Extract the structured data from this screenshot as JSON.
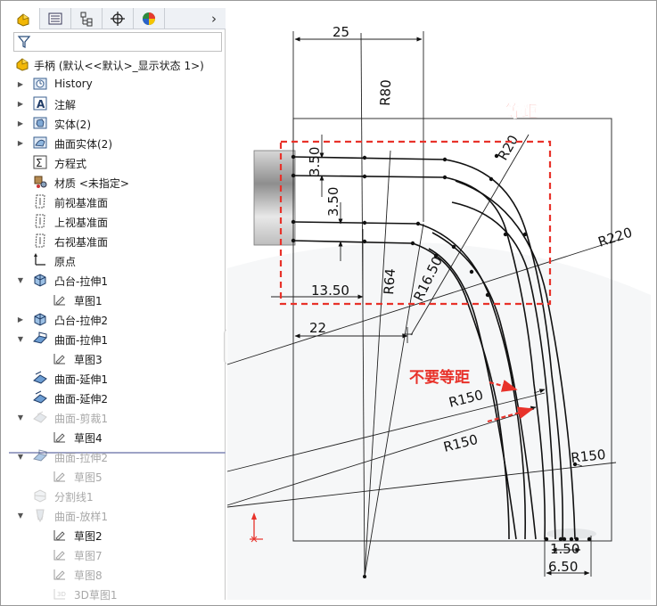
{
  "tree": {
    "root_label": "手柄 (默认<<默认>_显示状态 1>)",
    "items": [
      {
        "label": "History",
        "icon": "history-icon",
        "arrow": "right",
        "indent": 0,
        "dim": false
      },
      {
        "label": "注解",
        "icon": "annotation-icon",
        "arrow": "right",
        "indent": 0,
        "dim": false
      },
      {
        "label": "实体(2)",
        "icon": "solid-bodies-icon",
        "arrow": "right",
        "indent": 0,
        "dim": false
      },
      {
        "label": "曲面实体(2)",
        "icon": "surface-bodies-icon",
        "arrow": "right",
        "indent": 0,
        "dim": false
      },
      {
        "label": "方程式",
        "icon": "equation-icon",
        "arrow": "",
        "indent": 0,
        "dim": false
      },
      {
        "label": "材质 <未指定>",
        "icon": "material-icon",
        "arrow": "",
        "indent": 0,
        "dim": false
      },
      {
        "label": "前视基准面",
        "icon": "plane-icon",
        "arrow": "",
        "indent": 0,
        "dim": false
      },
      {
        "label": "上视基准面",
        "icon": "plane-icon",
        "arrow": "",
        "indent": 0,
        "dim": false
      },
      {
        "label": "右视基准面",
        "icon": "plane-icon",
        "arrow": "",
        "indent": 0,
        "dim": false
      },
      {
        "label": "原点",
        "icon": "origin-icon",
        "arrow": "",
        "indent": 0,
        "dim": false
      },
      {
        "label": "凸台-拉伸1",
        "icon": "boss-extrude-icon",
        "arrow": "down",
        "indent": 0,
        "dim": false
      },
      {
        "label": "草图1",
        "icon": "sketch-icon",
        "arrow": "",
        "indent": 1,
        "dim": false
      },
      {
        "label": "凸台-拉伸2",
        "icon": "boss-extrude-icon",
        "arrow": "right",
        "indent": 0,
        "dim": false
      },
      {
        "label": "曲面-拉伸1",
        "icon": "surface-extrude-icon",
        "arrow": "down",
        "indent": 0,
        "dim": false
      },
      {
        "label": "草图3",
        "icon": "sketch-icon",
        "arrow": "",
        "indent": 1,
        "dim": false
      },
      {
        "label": "曲面-延伸1",
        "icon": "surface-extend-icon",
        "arrow": "",
        "indent": 0,
        "dim": false
      },
      {
        "label": "曲面-延伸2",
        "icon": "surface-extend-icon",
        "arrow": "",
        "indent": 0,
        "dim": false
      },
      {
        "label": "曲面-剪裁1",
        "icon": "surface-trim-icon",
        "arrow": "down",
        "indent": 0,
        "dim": true
      },
      {
        "label": "草图4",
        "icon": "sketch-icon",
        "arrow": "",
        "indent": 1,
        "dim": false
      },
      {
        "label": "曲面-拉伸2",
        "icon": "surface-extrude-icon",
        "arrow": "down",
        "indent": 0,
        "dim": true
      },
      {
        "label": "草图5",
        "icon": "sketch-icon",
        "arrow": "",
        "indent": 1,
        "dim": true
      },
      {
        "label": "分割线1",
        "icon": "split-line-icon",
        "arrow": "",
        "indent": 0,
        "dim": true
      },
      {
        "label": "曲面-放样1",
        "icon": "surface-loft-icon",
        "arrow": "down",
        "indent": 0,
        "dim": true
      },
      {
        "label": "草图2",
        "icon": "sketch-icon",
        "arrow": "",
        "indent": 1,
        "dim": false
      },
      {
        "label": "草图7",
        "icon": "sketch-icon",
        "arrow": "",
        "indent": 1,
        "dim": true
      },
      {
        "label": "草图8",
        "icon": "sketch-icon",
        "arrow": "",
        "indent": 1,
        "dim": true
      },
      {
        "label": "3D草图1",
        "icon": "3d-sketch-icon",
        "arrow": "",
        "indent": 1,
        "dim": true
      }
    ]
  },
  "sketch": {
    "dimensions": {
      "d25": "25",
      "r80": "R80",
      "r20": "R20",
      "r220": "R220",
      "d350a": "3.50",
      "d350b": "3.50",
      "r1650": "R16.50",
      "r64": "R64",
      "d1350": "13.50",
      "d22": "22",
      "r150a": "R150",
      "r150b": "R150",
      "r150c": "R150",
      "d150": "1.50",
      "d650": "6.50"
    },
    "annotations": {
      "equal_distance": "等距",
      "not_equal_distance": "不要等距"
    },
    "annotation_color": "#e8322a"
  }
}
